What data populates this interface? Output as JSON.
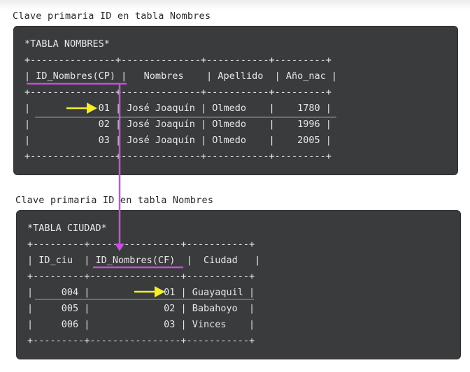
{
  "caption_top": "Clave primaria ID en tabla Nombres",
  "caption_bottom": "Clave primaria ID en tabla Nombres",
  "table1": {
    "lines": [
      "*TABLA NOMBRES*",
      "+---------------+--------------+-----------+---------+",
      "| ID_Nombres(CP) |   Nombres    | Apellido  | Año_nac |",
      "+---------------+--------------+-----------+---------+",
      "|            01 | José Joaquín | Olmedo    |    1780 |",
      "|            02 | José Joaquín | Olmedo    |    1996 |",
      "|            03 | José Joaquín | Olmedo    |    2005 |",
      "+---------------+--------------+-----------+---------+"
    ]
  },
  "table2": {
    "lines": [
      "*TABLA CIUDAD*",
      "+---------+----------------+-----------+",
      "| ID_ciu  | ID_Nombres(CF)  |  Ciudad   |",
      "+---------+----------------+-----------+",
      "|     004 |             01 | Guayaquil |",
      "|     005 |             02 | Babahoyo  |",
      "|     006 |             03 | Vinces    |",
      "+---------+----------------+-----------+"
    ]
  },
  "colors": {
    "panel": "#3a3b3d",
    "text": "#e6e6e6",
    "underline": "#c34fd6",
    "arrow_link": "#c84fe0",
    "arrow_pointer": "#f5ee2a"
  }
}
